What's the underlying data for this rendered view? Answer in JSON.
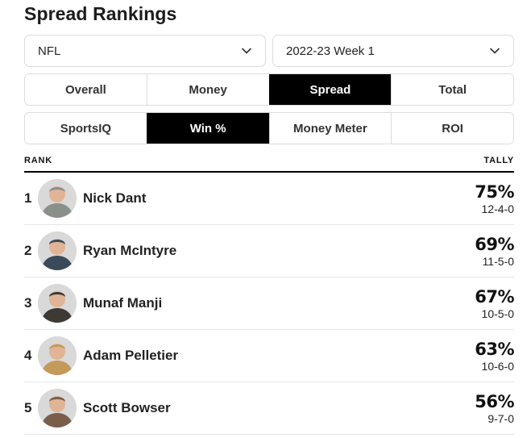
{
  "page": {
    "title": "Spread Rankings"
  },
  "filters": {
    "league": {
      "value": "NFL",
      "icon": "chevron-down-icon"
    },
    "week": {
      "value": "2022-23 Week 1",
      "icon": "chevron-down-icon"
    }
  },
  "category_tabs": [
    {
      "label": "Overall",
      "active": false
    },
    {
      "label": "Money",
      "active": false
    },
    {
      "label": "Spread",
      "active": true
    },
    {
      "label": "Total",
      "active": false
    }
  ],
  "metric_tabs": [
    {
      "label": "SportsIQ",
      "active": false
    },
    {
      "label": "Win %",
      "active": true
    },
    {
      "label": "Money Meter",
      "active": false
    },
    {
      "label": "ROI",
      "active": false
    }
  ],
  "table": {
    "headers": {
      "rank": "RANK",
      "tally": "TALLY"
    },
    "rows": [
      {
        "rank": "1",
        "name": "Nick Dant",
        "pct": "75%",
        "record": "12-4-0",
        "avatar_color": "#8a8f8a"
      },
      {
        "rank": "2",
        "name": "Ryan McIntyre",
        "pct": "69%",
        "record": "11-5-0",
        "avatar_color": "#3a4a5a"
      },
      {
        "rank": "3",
        "name": "Munaf Manji",
        "pct": "67%",
        "record": "10-5-0",
        "avatar_color": "#3d3a36"
      },
      {
        "rank": "4",
        "name": "Adam Pelletier",
        "pct": "63%",
        "record": "10-6-0",
        "avatar_color": "#c49a5a"
      },
      {
        "rank": "5",
        "name": "Scott Bowser",
        "pct": "56%",
        "record": "9-7-0",
        "avatar_color": "#7a5e4a"
      }
    ]
  }
}
